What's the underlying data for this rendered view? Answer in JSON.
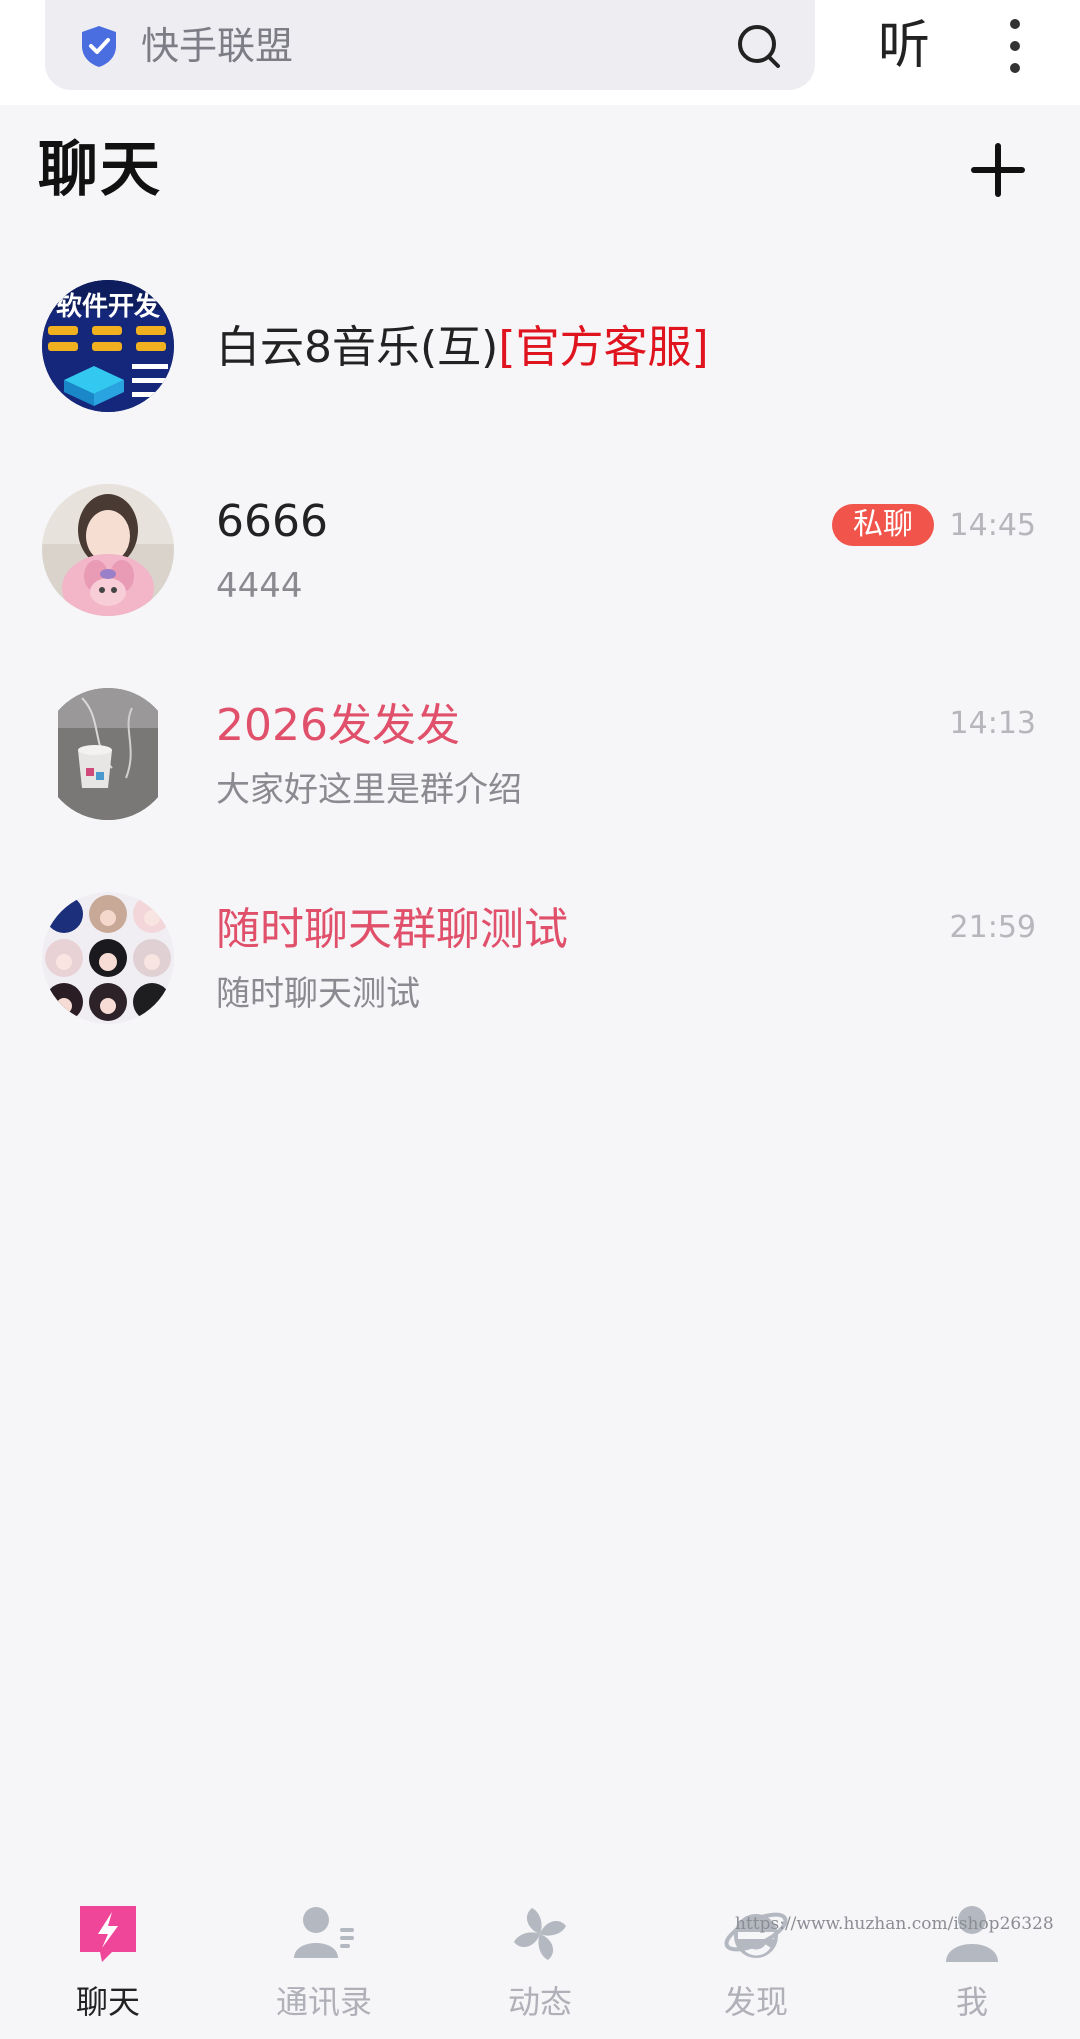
{
  "search": {
    "placeholder": "快手联盟",
    "listen_label": "听"
  },
  "header": {
    "title": "聊天"
  },
  "chats": [
    {
      "name": "白云8音乐(互)",
      "tag": "[官方客服]",
      "preview": "",
      "time": "",
      "badge": ""
    },
    {
      "name": "6666",
      "tag": "",
      "preview": "4444",
      "time": "14:45",
      "badge": "私聊"
    },
    {
      "name": "2026发发发",
      "tag": "",
      "preview": "大家好这里是群介绍",
      "time": "14:13",
      "badge": ""
    },
    {
      "name": "随时聊天群聊测试",
      "tag": "",
      "preview": "随时聊天测试",
      "time": "21:59",
      "badge": ""
    }
  ],
  "avatar_text": {
    "banner": "软件开发"
  },
  "nav": [
    {
      "label": "聊天",
      "icon": "chat-bolt-icon",
      "active": true
    },
    {
      "label": "通讯录",
      "icon": "contacts-icon",
      "active": false
    },
    {
      "label": "动态",
      "icon": "pinwheel-icon",
      "active": false
    },
    {
      "label": "发现",
      "icon": "browser-e-icon",
      "active": false
    },
    {
      "label": "我",
      "icon": "person-icon",
      "active": false
    }
  ],
  "watermark": "https://www.huzhan.com/ishop26328",
  "colors": {
    "accent": "#e0506a",
    "official": "#e0141e",
    "badge": "#f0544a",
    "nav_active": "#f0469a",
    "shield": "#4a6ee0"
  }
}
